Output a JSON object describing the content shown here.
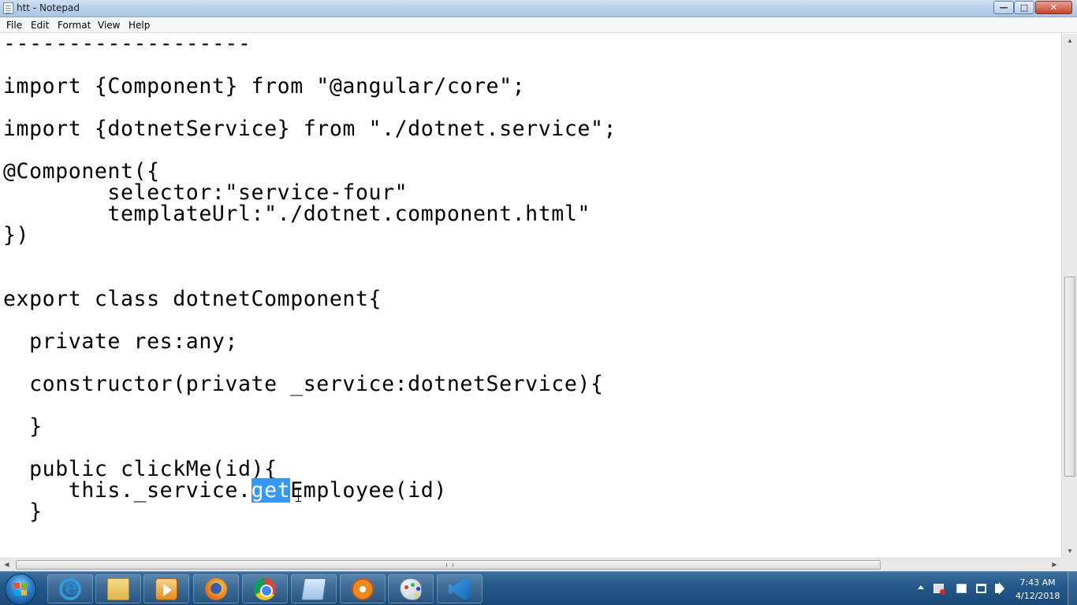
{
  "window": {
    "title": "htt - Notepad",
    "controls": {
      "minimize": "—",
      "maximize": "□",
      "close": "✕"
    }
  },
  "menu": [
    "File",
    "Edit",
    "Format",
    "View",
    "Help"
  ],
  "editor": {
    "lines": [
      "-------------------",
      "import {Component} from \"@angular/core\";",
      "import {dotnetService} from \"./dotnet.service\";",
      "@Component({",
      "        selector:\"service-four\"",
      "        templateUrl:\"./dotnet.component.html\"",
      "})",
      "export class dotnetComponent{",
      "  private res:any;",
      "  constructor(private _service:dotnetService){",
      "  }",
      "  public clickMe(id){",
      "     this._service.",
      "get",
      "Employee(id)",
      "  }"
    ],
    "selected_text": "get"
  },
  "taskbar": {
    "apps": [
      "internet-explorer",
      "windows-explorer",
      "media-player",
      "firefox",
      "chrome",
      "notepad",
      "flower-app",
      "paint",
      "visual-studio-code"
    ],
    "clock": {
      "time": "7:43 AM",
      "date": "4/12/2018"
    }
  },
  "colors": {
    "selection": "#3399ff",
    "taskbar": "#245a8c"
  }
}
